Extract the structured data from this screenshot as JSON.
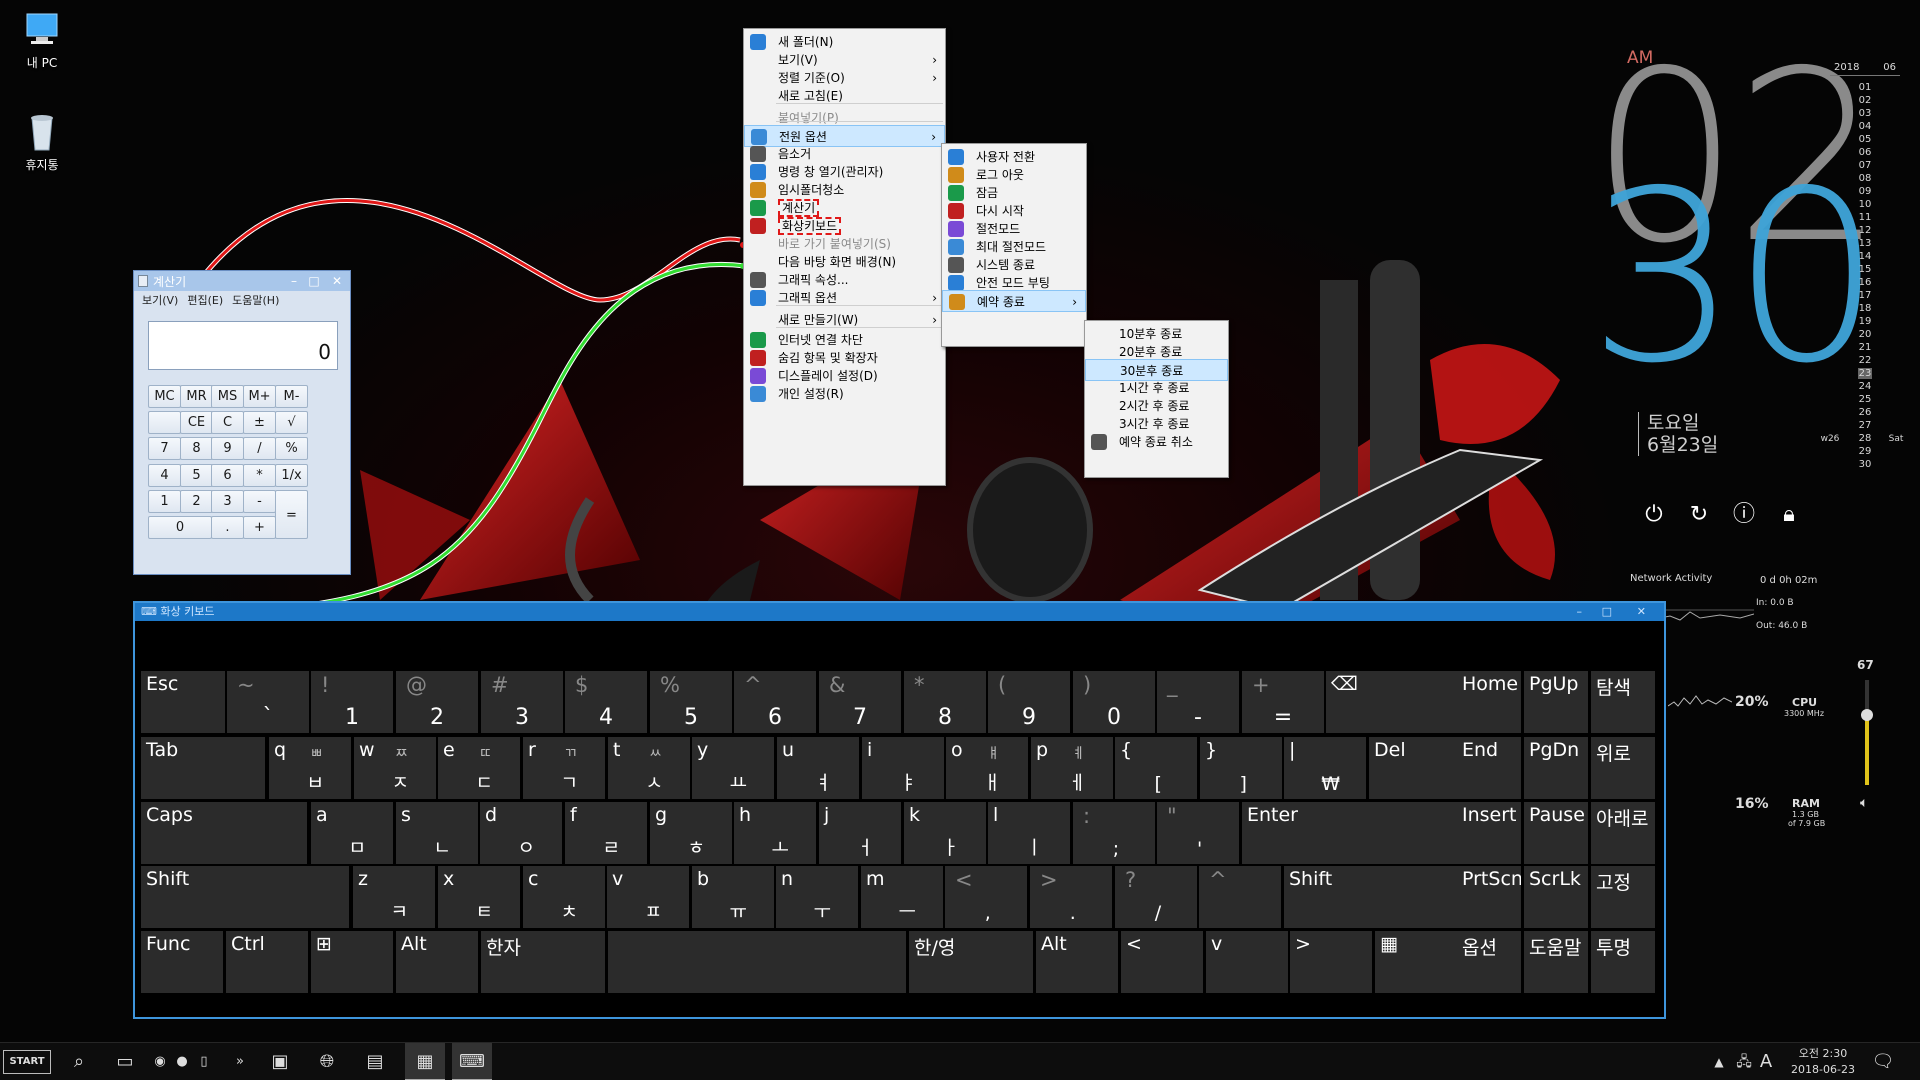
{
  "desktop": {
    "icons": [
      {
        "label": "내 PC",
        "icon": "computer-icon"
      },
      {
        "label": "휴지통",
        "icon": "recycle-bin-icon"
      }
    ]
  },
  "clock": {
    "ampm": "AM",
    "hour": "02",
    "minute": "30",
    "weekday": "토요일",
    "date": "6월23일"
  },
  "calendar": {
    "year": "2018",
    "month": "06",
    "days": [
      "01",
      "02",
      "03",
      "04",
      "05",
      "06",
      "07",
      "08",
      "09",
      "10",
      "11",
      "12",
      "13",
      "14",
      "15",
      "16",
      "17",
      "18",
      "19",
      "20",
      "21",
      "22",
      "23",
      "24",
      "25",
      "26",
      "27",
      "28",
      "29",
      "30"
    ],
    "week": "w26",
    "today_label": "Sat",
    "today": "23"
  },
  "meters": {
    "network_title": "Network Activity",
    "uptime": "0 d 0h 02m",
    "net_in": "In: 0.0 B",
    "net_out": "Out: 46.0 B",
    "cpu_pct": "20%",
    "cpu_label": "CPU",
    "cpu_freq": "3300 MHz",
    "ram_pct": "16%",
    "ram_label": "RAM",
    "ram_used": "1.3 GB",
    "ram_total": "of 7.9 GB",
    "volume": "67",
    "volume_level": 0.67
  },
  "calculator": {
    "title": "계산기",
    "menu": [
      "보기(V)",
      "편집(E)",
      "도움말(H)"
    ],
    "display": "0",
    "keys": [
      "MC",
      "MR",
      "MS",
      "M+",
      "M-",
      "",
      "CE",
      "C",
      "±",
      "√",
      "7",
      "8",
      "9",
      "/",
      "%",
      "4",
      "5",
      "6",
      "*",
      "1/x",
      "1",
      "2",
      "3",
      "-",
      "=",
      "0",
      ".",
      "+"
    ]
  },
  "context_menu": {
    "items": [
      {
        "label": "새 폴더(N)",
        "icon": "new-folder-icon"
      },
      {
        "label": "보기(V)",
        "submenu": true
      },
      {
        "label": "정렬 기준(O)",
        "submenu": true
      },
      {
        "label": "새로 고침(E)"
      },
      {
        "label": "붙여넣기(P)",
        "disabled": true
      },
      {
        "label": "전원 옵션",
        "submenu": true,
        "highlight": true,
        "icon": "power-options-icon"
      },
      {
        "label": "음소거",
        "icon": "speaker-icon"
      },
      {
        "label": "명령 창 열기(관리자)",
        "icon": "cmd-icon"
      },
      {
        "label": "임시폴더청소",
        "icon": "trash-icon"
      },
      {
        "label": "계산기",
        "icon": "calculator-icon",
        "boxed": true
      },
      {
        "label": "화상키보드",
        "icon": "keyboard-icon",
        "boxed": true
      },
      {
        "label": "바로 가기 붙여넣기(S)",
        "disabled": true
      },
      {
        "label": "다음 바탕 화면 배경(N)"
      },
      {
        "label": "그래픽 속성...",
        "icon": "graphics-icon"
      },
      {
        "label": "그래픽 옵션",
        "submenu": true,
        "icon": "graphics-options-icon"
      },
      {
        "label": "새로 만들기(W)",
        "submenu": true
      },
      {
        "label": "인터넷 연결 차단",
        "icon": "network-icon"
      },
      {
        "label": "숨김 항목 및 확장자",
        "icon": "hidden-items-icon"
      },
      {
        "label": "디스플레이 설정(D)",
        "icon": "display-icon"
      },
      {
        "label": "개인 설정(R)",
        "icon": "personalize-icon"
      }
    ]
  },
  "power_menu": {
    "items": [
      {
        "label": "사용자 전환",
        "icon": "switch-user-icon"
      },
      {
        "label": "로그 아웃",
        "icon": "logout-icon"
      },
      {
        "label": "잠금",
        "icon": "lock-icon"
      },
      {
        "label": "다시 시작",
        "icon": "restart-icon"
      },
      {
        "label": "절전모드",
        "icon": "sleep-icon"
      },
      {
        "label": "최대 절전모드",
        "icon": "hibernate-icon"
      },
      {
        "label": "시스템 종료",
        "icon": "shutdown-icon"
      },
      {
        "label": "안전 모드 부팅",
        "icon": "safe-mode-icon"
      },
      {
        "label": "예약 종료",
        "submenu": true,
        "highlight": true,
        "icon": "schedule-icon"
      }
    ]
  },
  "schedule_menu": {
    "items": [
      {
        "label": "10분후 종료"
      },
      {
        "label": "20분후 종료"
      },
      {
        "label": "30분후 종료",
        "highlight": true
      },
      {
        "label": "1시간 후 종료"
      },
      {
        "label": "2시간 후 종료"
      },
      {
        "label": "3시간 후 종료"
      },
      {
        "label": "예약 종료 취소",
        "icon": "cancel-icon"
      }
    ]
  },
  "keyboard": {
    "title": "화상 키보드",
    "row1": [
      [
        "Esc",
        ""
      ],
      [
        "~",
        "`"
      ],
      [
        "!",
        "1"
      ],
      [
        "@",
        "2"
      ],
      [
        "#",
        "3"
      ],
      [
        "$",
        "4"
      ],
      [
        "%",
        "5"
      ],
      [
        "^",
        "6"
      ],
      [
        "&",
        "7"
      ],
      [
        "*",
        "8"
      ],
      [
        "(",
        "9"
      ],
      [
        ")",
        "0"
      ],
      [
        "_",
        "-"
      ],
      [
        "+",
        "="
      ],
      [
        "⌫",
        ""
      ]
    ],
    "row2": [
      [
        "Tab",
        "",
        ""
      ],
      [
        "q",
        "ㅃ",
        "ㅂ"
      ],
      [
        "w",
        "ㅉ",
        "ㅈ"
      ],
      [
        "e",
        "ㄸ",
        "ㄷ"
      ],
      [
        "r",
        "ㄲ",
        "ㄱ"
      ],
      [
        "t",
        "ㅆ",
        "ㅅ"
      ],
      [
        "y",
        "",
        "ㅛ"
      ],
      [
        "u",
        "",
        "ㅕ"
      ],
      [
        "i",
        "",
        "ㅑ"
      ],
      [
        "o",
        "ㅒ",
        "ㅐ"
      ],
      [
        "p",
        "ㅖ",
        "ㅔ"
      ],
      [
        "{",
        "",
        "["
      ],
      [
        "}",
        "",
        "]"
      ],
      [
        "|",
        "",
        "₩"
      ],
      [
        "Del",
        "",
        ""
      ]
    ],
    "row3": [
      [
        "Caps",
        ""
      ],
      [
        "a",
        "ㅁ"
      ],
      [
        "s",
        "ㄴ"
      ],
      [
        "d",
        "ㅇ"
      ],
      [
        "f",
        "ㄹ"
      ],
      [
        "g",
        "ㅎ"
      ],
      [
        "h",
        "ㅗ"
      ],
      [
        "j",
        "ㅓ"
      ],
      [
        "k",
        "ㅏ"
      ],
      [
        "l",
        "ㅣ"
      ],
      [
        ":",
        ";"
      ],
      [
        "\"",
        "'"
      ],
      [
        "Enter",
        ""
      ]
    ],
    "row4": [
      [
        "Shift",
        ""
      ],
      [
        "z",
        "ㅋ"
      ],
      [
        "x",
        "ㅌ"
      ],
      [
        "c",
        "ㅊ"
      ],
      [
        "v",
        "ㅍ"
      ],
      [
        "b",
        "ㅠ"
      ],
      [
        "n",
        "ㅜ"
      ],
      [
        "m",
        "ㅡ"
      ],
      [
        "<",
        ","
      ],
      [
        ">",
        "."
      ],
      [
        "?",
        "/"
      ],
      [
        "^",
        ""
      ],
      [
        "Shift",
        ""
      ]
    ],
    "row5": [
      "Func",
      "Ctrl",
      "⊞",
      "Alt",
      "한자",
      "",
      "한/영",
      "Alt",
      "<",
      "v",
      ">",
      "▦"
    ],
    "nav": [
      "Home",
      "PgUp",
      "탐색",
      "End",
      "PgDn",
      "위로",
      "Insert",
      "Pause",
      "아래로",
      "PrtScn",
      "ScrLk",
      "고정",
      "옵션",
      "도움말",
      "투명"
    ]
  },
  "taskbar": {
    "start_label": "START",
    "time": "오전 2:30",
    "date": "2018-06-23",
    "ime": "A"
  }
}
